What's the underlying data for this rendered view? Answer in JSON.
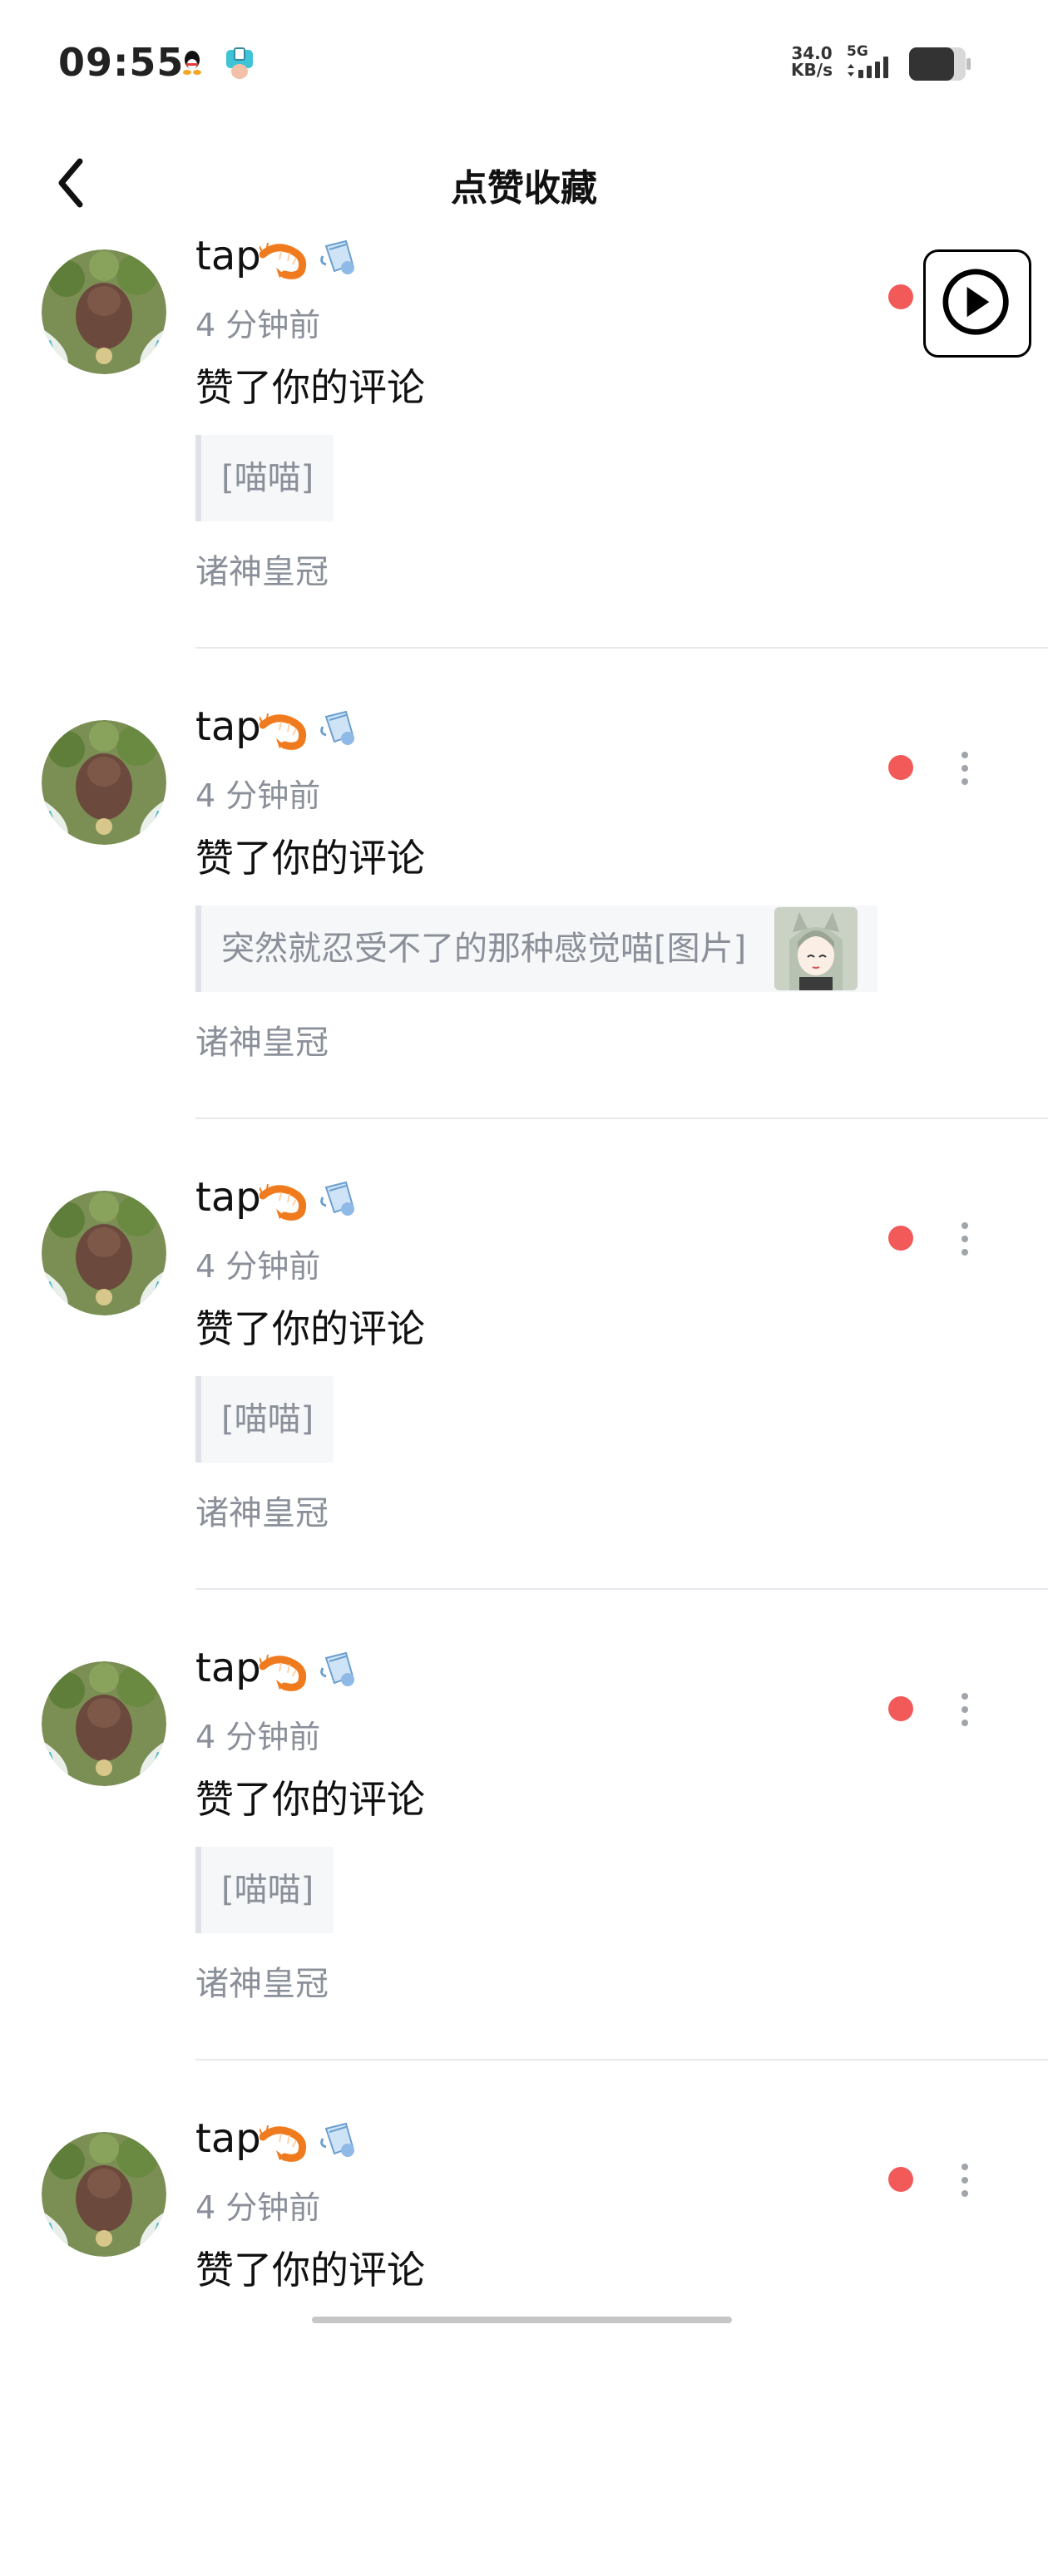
{
  "status_bar": {
    "time": "09:55",
    "net_speed_value": "34.0",
    "net_speed_unit": "KB/s",
    "network": "5G"
  },
  "header": {
    "title": "点赞收藏"
  },
  "items": [
    {
      "username": "tap",
      "time_ago": "4 分钟前",
      "action": "赞了你的评论",
      "quote": "[喵喵]",
      "source": "诸神皇冠"
    },
    {
      "username": "tap",
      "time_ago": "4 分钟前",
      "action": "赞了你的评论",
      "quote": "突然就忍受不了的那种感觉喵[图片]",
      "source": "诸神皇冠"
    },
    {
      "username": "tap",
      "time_ago": "4 分钟前",
      "action": "赞了你的评论",
      "quote": "[喵喵]",
      "source": "诸神皇冠"
    },
    {
      "username": "tap",
      "time_ago": "4 分钟前",
      "action": "赞了你的评论",
      "quote": "[喵喵]",
      "source": "诸神皇冠"
    },
    {
      "username": "tap",
      "time_ago": "4 分钟前",
      "action": "赞了你的评论"
    }
  ],
  "colors": {
    "unread": "#f25a5a",
    "muted_text": "#8a8f99",
    "quote_bg": "#f6f7f8"
  }
}
